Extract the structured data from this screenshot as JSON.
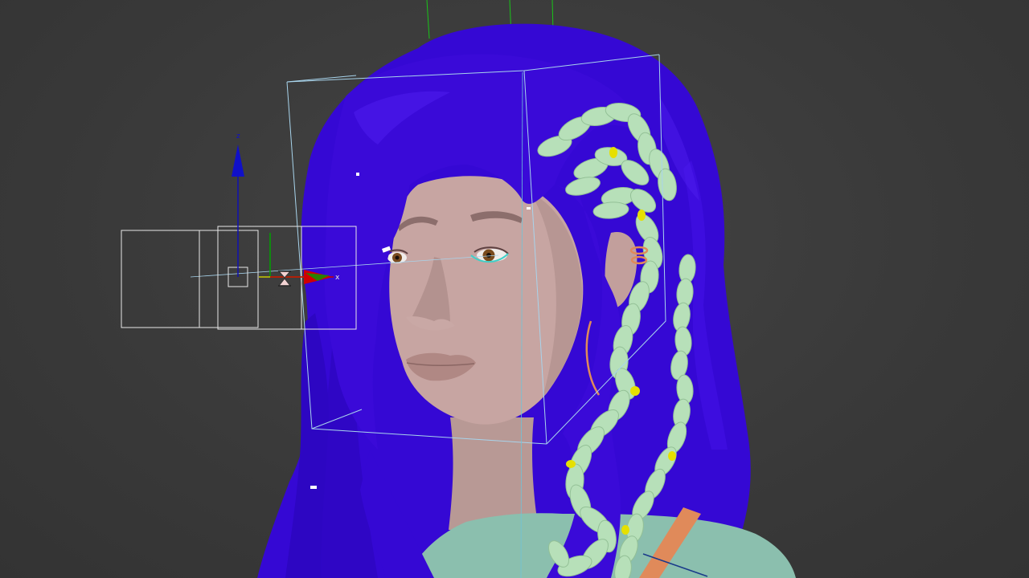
{
  "viewport": {
    "type": "3d-perspective",
    "background_color": "#3a3a3a"
  },
  "gizmo": {
    "x_axis_label": "x",
    "z_axis_label": "z",
    "x_axis_color": "#c00000",
    "y_axis_color": "#00a000",
    "z_axis_color": "#1010b0"
  },
  "model": {
    "hair_color": "#3a0ad8",
    "braid_color": "#b8e0b8",
    "skin_color": "#c9a7a4",
    "shirt_color": "#8cc0b0",
    "accessory_color": "#e08a5a",
    "bead_color": "#e8e000"
  },
  "selection_box_color": "#a8d4ec",
  "light_icon": "hourglass-light-icon"
}
